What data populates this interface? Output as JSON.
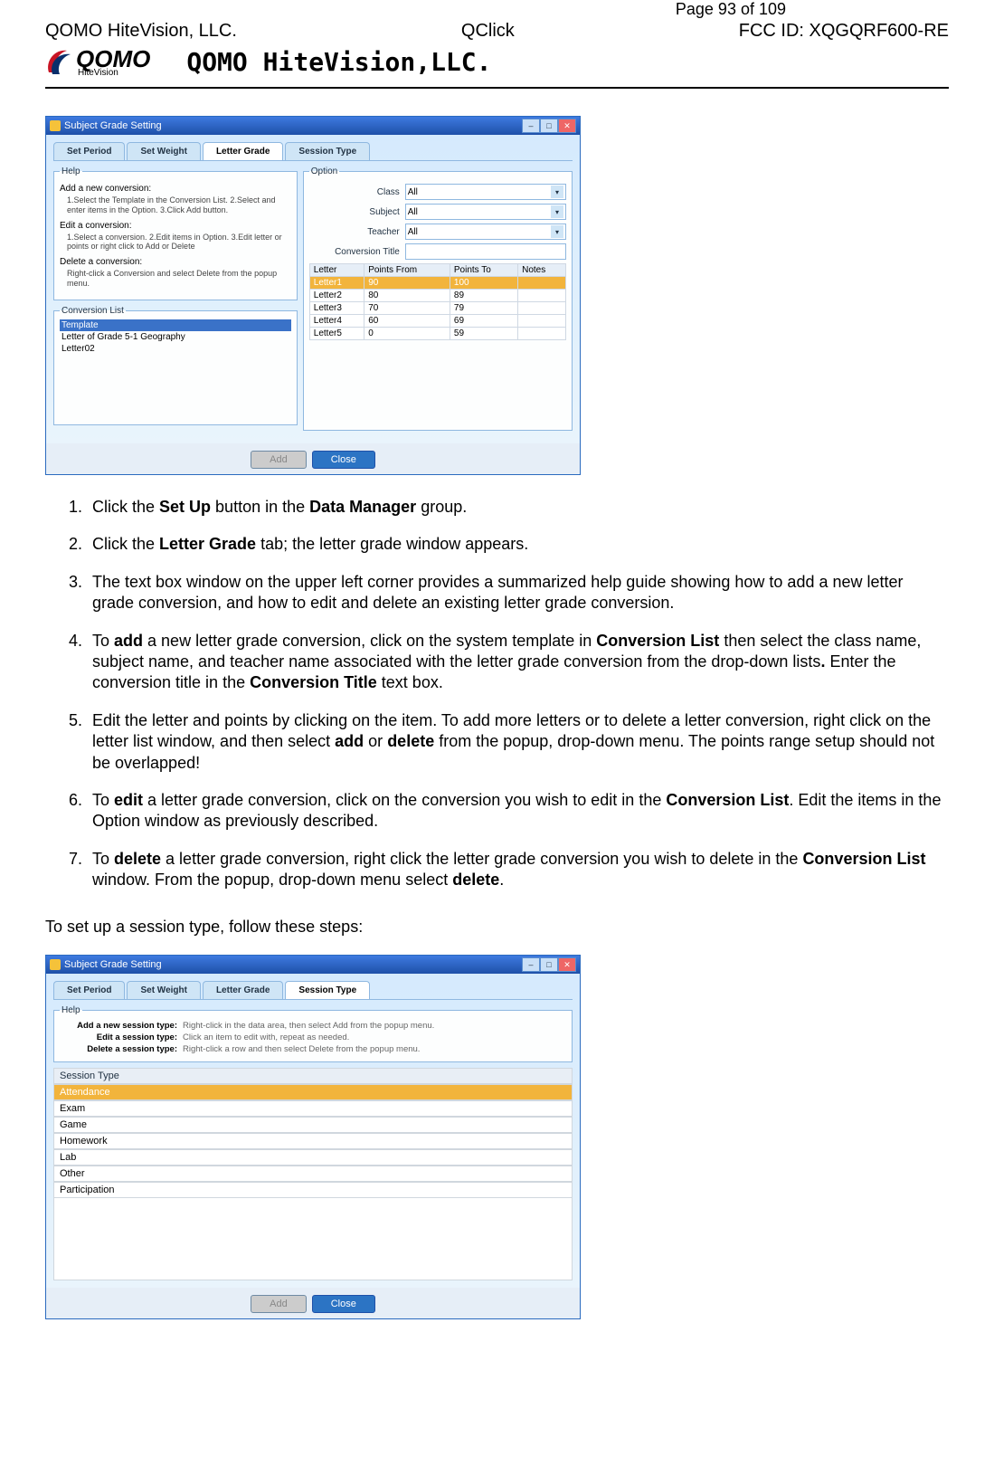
{
  "page_number": "Page 93 of 109",
  "header": {
    "left": "QOMO HiteVision, LLC.",
    "center": "QClick",
    "right": "FCC ID: XQGQRF600-RE",
    "logo_main": "QOMO",
    "logo_sub": "HiteVision",
    "title": "QOMO HiteVision,LLC."
  },
  "app1": {
    "title": "Subject Grade Setting",
    "tabs": [
      "Set Period",
      "Set Weight",
      "Letter Grade",
      "Session Type"
    ],
    "active_tab": 2,
    "help_legend": "Help",
    "help": [
      {
        "head": "Add a new conversion:",
        "body": "1.Select the Template in the Conversion List. 2.Select and enter items in the Option. 3.Click Add button."
      },
      {
        "head": "Edit a conversion:",
        "body": "1.Select a conversion. 2.Edit items in Option. 3.Edit letter or points or right click to Add or Delete"
      },
      {
        "head": "Delete a conversion:",
        "body": "Right-click a Conversion and select Delete from the popup menu."
      }
    ],
    "conv_list_legend": "Conversion List",
    "conv_list": [
      "Template",
      "Letter of Grade 5-1 Geography",
      "Letter02"
    ],
    "conv_selected": 0,
    "option_legend": "Option",
    "option_fields": [
      {
        "label": "Class",
        "value": "All",
        "dropdown": true
      },
      {
        "label": "Subject",
        "value": "All",
        "dropdown": true
      },
      {
        "label": "Teacher",
        "value": "All",
        "dropdown": true
      },
      {
        "label": "Conversion Title",
        "value": "",
        "dropdown": false
      }
    ],
    "table_headers": [
      "Letter",
      "Points From",
      "Points To",
      "Notes"
    ],
    "table_rows": [
      [
        "Letter1",
        "90",
        "100",
        ""
      ],
      [
        "Letter2",
        "80",
        "89",
        ""
      ],
      [
        "Letter3",
        "70",
        "79",
        ""
      ],
      [
        "Letter4",
        "60",
        "69",
        ""
      ],
      [
        "Letter5",
        "0",
        "59",
        ""
      ]
    ],
    "table_selected": 0,
    "buttons": {
      "disabled": "Add",
      "primary": "Close"
    }
  },
  "steps": [
    {
      "pre": "Click the ",
      "b1": "Set Up",
      "mid": " button in the ",
      "b2": "Data Manager",
      "post": " group."
    },
    {
      "pre": "Click the ",
      "b1": "Letter Grade",
      "post": " tab; the letter grade window appears."
    },
    {
      "full": "The text box window on the upper left corner provides a summarized help guide showing how to add a new letter grade conversion, and how to edit and delete an existing letter grade conversion."
    },
    {
      "pre": "To ",
      "b1": "add",
      "mid": " a new letter grade conversion, click on the system template in ",
      "b2": "Conversion List",
      "mid2": " then select the class name, subject name, and teacher name associated with the letter grade conversion from the drop-down lists",
      "b3": ".",
      "mid3": " Enter the conversion title in the ",
      "b4": "Conversion Title",
      "post": " text box."
    },
    {
      "pre": "Edit the letter and points by clicking on the item. To add more letters or to delete a letter conversion, right click on the letter list window, and then select ",
      "b1": "add",
      "mid": " or ",
      "b2": "delete",
      "post": " from the popup, drop-down menu. The points range setup should not be overlapped!"
    },
    {
      "pre": "To ",
      "b1": "edit",
      "mid": " a letter grade conversion, click on the conversion you wish to edit in the ",
      "b2": "Conversion List",
      "post": ". Edit the items in the Option window as previously described."
    },
    {
      "pre": "To ",
      "b1": "delete",
      "mid": " a letter grade conversion, right click the letter grade conversion you wish to delete in the ",
      "b2": "Conversion List",
      "mid2": " window. From the popup, drop-down menu select ",
      "b3": "delete",
      "post": "."
    }
  ],
  "section_intro": "To set up a session type, follow these steps:",
  "app2": {
    "title": "Subject Grade Setting",
    "tabs": [
      "Set Period",
      "Set Weight",
      "Letter Grade",
      "Session Type"
    ],
    "active_tab": 3,
    "help_legend": "Help",
    "help2": [
      {
        "label": "Add a new session type:",
        "text": "Right-click in the data area, then select Add from the popup menu."
      },
      {
        "label": "Edit a session type:",
        "text": "Click an item to edit with, repeat as needed."
      },
      {
        "label": "Delete a session type:",
        "text": "Right-click a row and then select Delete from the popup menu."
      }
    ],
    "session_header": "Session Type",
    "sessions": [
      "Attendance",
      "Exam",
      "Game",
      "Homework",
      "Lab",
      "Other",
      "Participation"
    ],
    "session_selected": 0,
    "buttons": {
      "disabled": "Add",
      "primary": "Close"
    }
  }
}
